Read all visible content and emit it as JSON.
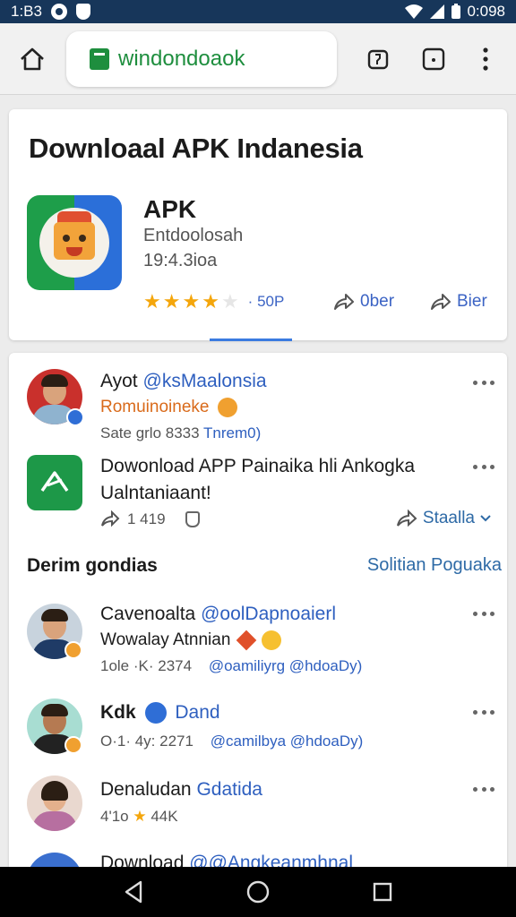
{
  "status_bar": {
    "time": "1:B3",
    "right_text": "0:098"
  },
  "browser": {
    "url": "windondoaok"
  },
  "app_card": {
    "title": "Downloaal APK Indanesia",
    "app_name": "APK",
    "developer": "Entdoolosah",
    "size": "19:4.3ioa",
    "rating": 4,
    "rating_max": 5,
    "rating_value": "50P",
    "open_label": "0ber",
    "share_label": "Bier",
    "colors": {
      "accent": "#3b63c4",
      "star": "#f4a60c",
      "brand_green": "#1e8e3e"
    }
  },
  "feed": {
    "post1": {
      "name": "Ayot",
      "handle": "@ksMaalonsia",
      "subtitle": "Romuinoineke",
      "meta": "Sate grlo 8333",
      "meta_link": "Tnrem0)"
    },
    "post2": {
      "title": "Dowonload APP Painaika hli Ankogka Ualntaniaant!",
      "count": "1 419",
      "share_label": "Staalla"
    },
    "section": {
      "title": "Derim gondias",
      "link": "Solitian Poguaka"
    },
    "post3": {
      "name": "Cavenoalta",
      "handle": "@oolDapnoaierl",
      "subtitle": "Wowalay Atnnian",
      "meta": "1ole ·K· 2374",
      "meta_handle": "@oamiliyrg @hdoaDy)"
    },
    "post4": {
      "name": "Kdk",
      "handle": "Dand",
      "meta": "O·1· 4y: 2271",
      "meta_handle": "@camilbya @hdoaDy)"
    },
    "post5": {
      "name": "Denaludan",
      "handle": "Gdatida",
      "meta_left": "4'1o",
      "meta_right": "44K"
    },
    "post6": {
      "title": "Download",
      "handle": "@@Angkeanmhnal"
    }
  }
}
